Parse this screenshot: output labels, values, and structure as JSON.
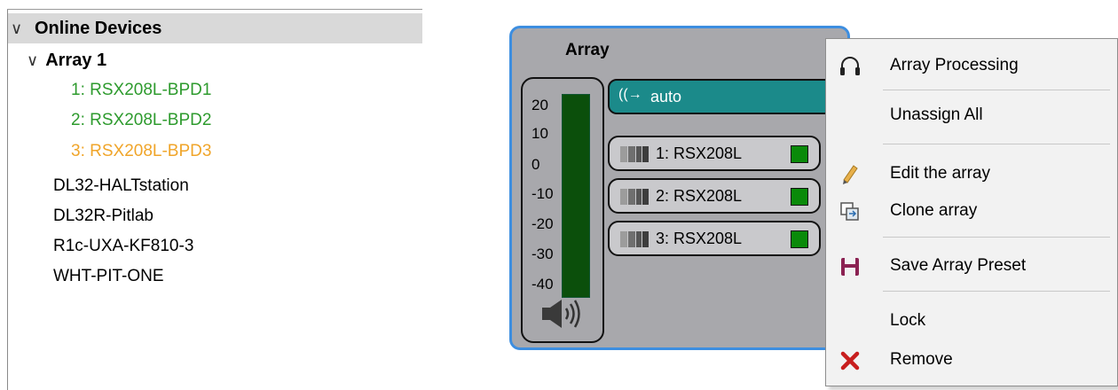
{
  "tree": {
    "root_label": "Online Devices",
    "group_label": "Array 1",
    "array_items": [
      {
        "label": "1: RSX208L-BPD1",
        "color": "#2e9b2e"
      },
      {
        "label": "2: RSX208L-BPD2",
        "color": "#2e9b2e"
      },
      {
        "label": "3: RSX208L-BPD3",
        "color": "#f0a52a"
      }
    ],
    "devices": [
      "DL32-HALTstation",
      "DL32R-Pitlab",
      "R1c-UXA-KF810-3",
      "WHT-PIT-ONE"
    ]
  },
  "array_panel": {
    "title": "Array",
    "meter_scale": [
      "20",
      "10",
      "0",
      "-10",
      "-20",
      "-30",
      "-40"
    ],
    "output_mode": "auto",
    "channels": [
      "1: RSX208L",
      "2: RSX208L",
      "3: RSX208L"
    ],
    "accent_color": "#3d8ee0"
  },
  "context_menu": {
    "items": [
      {
        "label": "Array Processing",
        "icon": "headphones-icon"
      },
      {
        "label": "Unassign All",
        "icon": ""
      },
      {
        "label": "Edit the array",
        "icon": "pencil-icon"
      },
      {
        "label": "Clone array",
        "icon": "clone-icon"
      },
      {
        "label": "Save Array Preset",
        "icon": "save-icon"
      },
      {
        "label": "Lock",
        "icon": ""
      },
      {
        "label": "Remove",
        "icon": "remove-x-icon"
      }
    ]
  }
}
